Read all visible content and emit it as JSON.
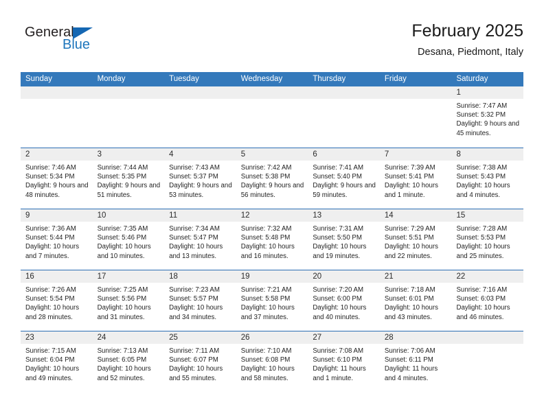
{
  "brand": {
    "name_part1": "General",
    "name_part2": "Blue",
    "flag_icon": "blue-triangle-flag",
    "accent_color": "#1c75bc"
  },
  "header": {
    "title": "February 2025",
    "subtitle": "Desana, Piedmont, Italy"
  },
  "theme": {
    "header_row_bg": "#3479bb",
    "row_divider": "#2a6db3",
    "day_band_bg": "#efefef",
    "cell_bg": "#ffffff",
    "text": "#1a1a1a"
  },
  "calendar": {
    "weekdays": [
      "Sunday",
      "Monday",
      "Tuesday",
      "Wednesday",
      "Thursday",
      "Friday",
      "Saturday"
    ],
    "weeks": [
      [
        {
          "day": "",
          "empty": true
        },
        {
          "day": "",
          "empty": true
        },
        {
          "day": "",
          "empty": true
        },
        {
          "day": "",
          "empty": true
        },
        {
          "day": "",
          "empty": true
        },
        {
          "day": "",
          "empty": true
        },
        {
          "day": "1",
          "sunrise": "Sunrise: 7:47 AM",
          "sunset": "Sunset: 5:32 PM",
          "daylight": "Daylight: 9 hours and 45 minutes."
        }
      ],
      [
        {
          "day": "2",
          "sunrise": "Sunrise: 7:46 AM",
          "sunset": "Sunset: 5:34 PM",
          "daylight": "Daylight: 9 hours and 48 minutes."
        },
        {
          "day": "3",
          "sunrise": "Sunrise: 7:44 AM",
          "sunset": "Sunset: 5:35 PM",
          "daylight": "Daylight: 9 hours and 51 minutes."
        },
        {
          "day": "4",
          "sunrise": "Sunrise: 7:43 AM",
          "sunset": "Sunset: 5:37 PM",
          "daylight": "Daylight: 9 hours and 53 minutes."
        },
        {
          "day": "5",
          "sunrise": "Sunrise: 7:42 AM",
          "sunset": "Sunset: 5:38 PM",
          "daylight": "Daylight: 9 hours and 56 minutes."
        },
        {
          "day": "6",
          "sunrise": "Sunrise: 7:41 AM",
          "sunset": "Sunset: 5:40 PM",
          "daylight": "Daylight: 9 hours and 59 minutes."
        },
        {
          "day": "7",
          "sunrise": "Sunrise: 7:39 AM",
          "sunset": "Sunset: 5:41 PM",
          "daylight": "Daylight: 10 hours and 1 minute."
        },
        {
          "day": "8",
          "sunrise": "Sunrise: 7:38 AM",
          "sunset": "Sunset: 5:43 PM",
          "daylight": "Daylight: 10 hours and 4 minutes."
        }
      ],
      [
        {
          "day": "9",
          "sunrise": "Sunrise: 7:36 AM",
          "sunset": "Sunset: 5:44 PM",
          "daylight": "Daylight: 10 hours and 7 minutes."
        },
        {
          "day": "10",
          "sunrise": "Sunrise: 7:35 AM",
          "sunset": "Sunset: 5:46 PM",
          "daylight": "Daylight: 10 hours and 10 minutes."
        },
        {
          "day": "11",
          "sunrise": "Sunrise: 7:34 AM",
          "sunset": "Sunset: 5:47 PM",
          "daylight": "Daylight: 10 hours and 13 minutes."
        },
        {
          "day": "12",
          "sunrise": "Sunrise: 7:32 AM",
          "sunset": "Sunset: 5:48 PM",
          "daylight": "Daylight: 10 hours and 16 minutes."
        },
        {
          "day": "13",
          "sunrise": "Sunrise: 7:31 AM",
          "sunset": "Sunset: 5:50 PM",
          "daylight": "Daylight: 10 hours and 19 minutes."
        },
        {
          "day": "14",
          "sunrise": "Sunrise: 7:29 AM",
          "sunset": "Sunset: 5:51 PM",
          "daylight": "Daylight: 10 hours and 22 minutes."
        },
        {
          "day": "15",
          "sunrise": "Sunrise: 7:28 AM",
          "sunset": "Sunset: 5:53 PM",
          "daylight": "Daylight: 10 hours and 25 minutes."
        }
      ],
      [
        {
          "day": "16",
          "sunrise": "Sunrise: 7:26 AM",
          "sunset": "Sunset: 5:54 PM",
          "daylight": "Daylight: 10 hours and 28 minutes."
        },
        {
          "day": "17",
          "sunrise": "Sunrise: 7:25 AM",
          "sunset": "Sunset: 5:56 PM",
          "daylight": "Daylight: 10 hours and 31 minutes."
        },
        {
          "day": "18",
          "sunrise": "Sunrise: 7:23 AM",
          "sunset": "Sunset: 5:57 PM",
          "daylight": "Daylight: 10 hours and 34 minutes."
        },
        {
          "day": "19",
          "sunrise": "Sunrise: 7:21 AM",
          "sunset": "Sunset: 5:58 PM",
          "daylight": "Daylight: 10 hours and 37 minutes."
        },
        {
          "day": "20",
          "sunrise": "Sunrise: 7:20 AM",
          "sunset": "Sunset: 6:00 PM",
          "daylight": "Daylight: 10 hours and 40 minutes."
        },
        {
          "day": "21",
          "sunrise": "Sunrise: 7:18 AM",
          "sunset": "Sunset: 6:01 PM",
          "daylight": "Daylight: 10 hours and 43 minutes."
        },
        {
          "day": "22",
          "sunrise": "Sunrise: 7:16 AM",
          "sunset": "Sunset: 6:03 PM",
          "daylight": "Daylight: 10 hours and 46 minutes."
        }
      ],
      [
        {
          "day": "23",
          "sunrise": "Sunrise: 7:15 AM",
          "sunset": "Sunset: 6:04 PM",
          "daylight": "Daylight: 10 hours and 49 minutes."
        },
        {
          "day": "24",
          "sunrise": "Sunrise: 7:13 AM",
          "sunset": "Sunset: 6:05 PM",
          "daylight": "Daylight: 10 hours and 52 minutes."
        },
        {
          "day": "25",
          "sunrise": "Sunrise: 7:11 AM",
          "sunset": "Sunset: 6:07 PM",
          "daylight": "Daylight: 10 hours and 55 minutes."
        },
        {
          "day": "26",
          "sunrise": "Sunrise: 7:10 AM",
          "sunset": "Sunset: 6:08 PM",
          "daylight": "Daylight: 10 hours and 58 minutes."
        },
        {
          "day": "27",
          "sunrise": "Sunrise: 7:08 AM",
          "sunset": "Sunset: 6:10 PM",
          "daylight": "Daylight: 11 hours and 1 minute."
        },
        {
          "day": "28",
          "sunrise": "Sunrise: 7:06 AM",
          "sunset": "Sunset: 6:11 PM",
          "daylight": "Daylight: 11 hours and 4 minutes."
        },
        {
          "day": "",
          "empty": true
        }
      ]
    ]
  }
}
